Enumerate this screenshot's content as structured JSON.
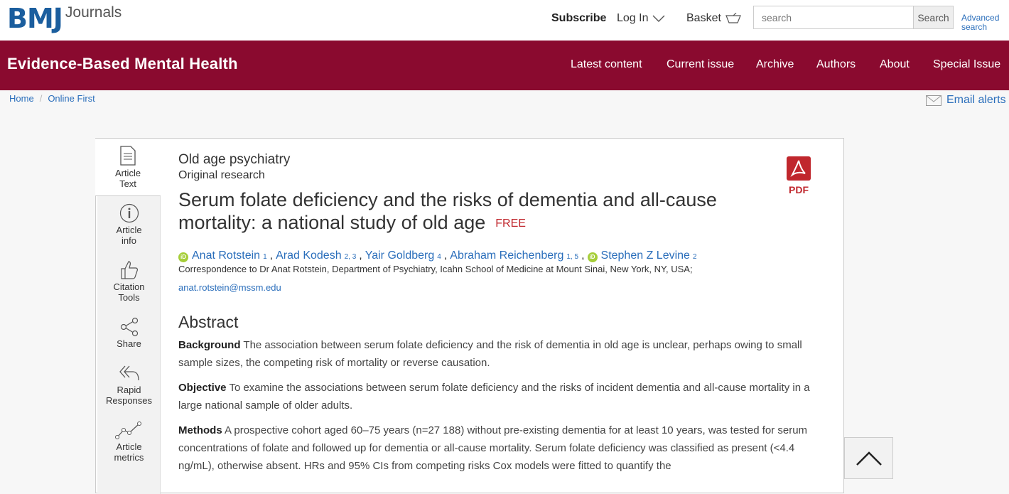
{
  "brand": {
    "logo_main": "BMJ",
    "logo_sub": "Journals"
  },
  "header": {
    "subscribe": "Subscribe",
    "login": "Log In",
    "basket": "Basket",
    "search_placeholder": "search",
    "search_button": "Search",
    "advanced_search": [
      "Advanced",
      "search"
    ]
  },
  "journal": {
    "title": "Evidence-Based Mental Health",
    "nav": [
      "Latest content",
      "Current issue",
      "Archive",
      "Authors",
      "About",
      "Special Issue"
    ]
  },
  "breadcrumb": {
    "items": [
      "Home",
      "Online First"
    ],
    "separator": "/"
  },
  "email_alerts": "Email alerts",
  "side_tools": [
    {
      "label": [
        "Article",
        "Text"
      ],
      "icon": "document-icon"
    },
    {
      "label": [
        "Article",
        "info"
      ],
      "icon": "info-icon"
    },
    {
      "label": [
        "Citation",
        "Tools"
      ],
      "icon": "thumbs-up-icon"
    },
    {
      "label": [
        "Share"
      ],
      "icon": "share-icon"
    },
    {
      "label": [
        "Rapid",
        "Responses"
      ],
      "icon": "reply-all-icon"
    },
    {
      "label": [
        "Article",
        "metrics"
      ],
      "icon": "chart-line-icon"
    }
  ],
  "article": {
    "section": "Old age psychiatry",
    "type": "Original research",
    "title": "Serum folate deficiency and the risks of dementia and all-cause mortality: a national study of old age",
    "free": "FREE",
    "pdf": "PDF",
    "authors": [
      {
        "name": "Anat Rotstein",
        "aff": "1",
        "orcid": true
      },
      {
        "name": "Arad Kodesh",
        "aff": "2, 3",
        "orcid": false
      },
      {
        "name": "Yair Goldberg",
        "aff": "4",
        "orcid": false
      },
      {
        "name": "Abraham Reichenberg",
        "aff": "1, 5",
        "orcid": false
      },
      {
        "name": "Stephen Z Levine",
        "aff": "2",
        "orcid": true
      }
    ],
    "orcid_mark": "iD",
    "correspondence_label": "Correspondence to",
    "correspondence_text": "Dr Anat Rotstein, Department of Psychiatry, Icahn School of Medicine at Mount Sinai, New York, NY, USA;",
    "email": "anat.rotstein@mssm.edu",
    "abstract_heading": "Abstract",
    "abstract": {
      "background_label": "Background",
      "background": "The association between serum folate deficiency and the risk of dementia in old age is unclear, perhaps owing to small sample sizes, the competing risk of mortality or reverse causation.",
      "objective_label": "Objective",
      "objective": "To examine the associations between serum folate deficiency and the risks of incident dementia and all-cause mortality in a large national sample of older adults.",
      "methods_label": "Methods",
      "methods": "A prospective cohort aged 60–75 years (n=27 188) without pre-existing dementia for at least 10 years, was tested for serum concentrations of folate and followed up for dementia or all-cause mortality. Serum folate deficiency was classified as present (<4.4 ng/mL), otherwise absent. HRs and 95% CIs from competing risks Cox models were fitted to quantify the"
    }
  },
  "colors": {
    "brand_red": "#8a0a2f",
    "link_blue": "#2a6ebb",
    "orcid_green": "#a6ce39",
    "pdf_red": "#c0272d"
  }
}
